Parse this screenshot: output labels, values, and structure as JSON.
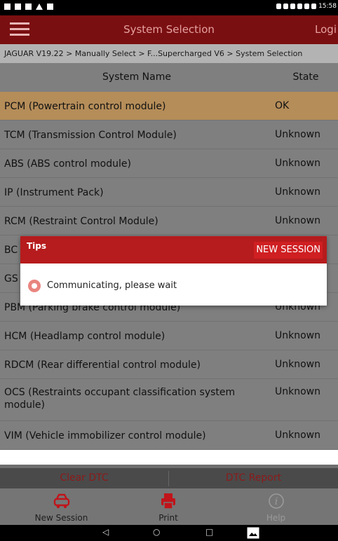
{
  "status_bar": {
    "time": "15:58",
    "left_icons": [
      "notification-icon",
      "image-icon",
      "square-icon",
      "warning-icon",
      "notification-icon"
    ],
    "right_icons": [
      "location-icon",
      "bluetooth-icon",
      "vibrate-icon",
      "wifi-icon",
      "sim-icon",
      "battery-icon"
    ]
  },
  "app_bar": {
    "title": "System Selection",
    "login_label": "Logi"
  },
  "breadcrumb": "JAGUAR V19.22 > Manually Select > F...Supercharged V6 > System Selection",
  "table": {
    "headers": {
      "name": "System Name",
      "state": "State"
    },
    "rows": [
      {
        "name": "PCM (Powertrain control module)",
        "state": "OK",
        "selected": true
      },
      {
        "name": "TCM (Transmission Control Module)",
        "state": "Unknown"
      },
      {
        "name": "ABS (ABS control module)",
        "state": "Unknown"
      },
      {
        "name": "IP (Instrument Pack)",
        "state": "Unknown"
      },
      {
        "name": "RCM (Restraint Control Module)",
        "state": "Unknown"
      },
      {
        "name": "BC",
        "state": ""
      },
      {
        "name": "GS",
        "state": ""
      },
      {
        "name": "PBM (Parking brake control module)",
        "state": "Unknown"
      },
      {
        "name": "HCM (Headlamp control module)",
        "state": "Unknown"
      },
      {
        "name": "RDCM (Rear differential control module)",
        "state": "Unknown"
      },
      {
        "name": "OCS (Restraints occupant classification system module)",
        "state": "Unknown",
        "tall": true
      },
      {
        "name": "VIM (Vehicle immobilizer control module)",
        "state": "Unknown"
      }
    ]
  },
  "actions": {
    "clear_dtc": "Clear DTC",
    "dtc_report": "DTC Report"
  },
  "bottom_nav": [
    {
      "label": "New Session",
      "icon": "car-icon"
    },
    {
      "label": "Print",
      "icon": "printer-icon"
    },
    {
      "label": "Help",
      "icon": "info-icon"
    }
  ],
  "dialog": {
    "title": "Tips",
    "button": "NEW SESSION",
    "message": "Communicating, please wait"
  },
  "colors": {
    "app_bar": "#7a0f11",
    "dialog_header": "#b61b1d",
    "selected_row": "#b58d59",
    "dim_row": "#7f7f7f"
  }
}
